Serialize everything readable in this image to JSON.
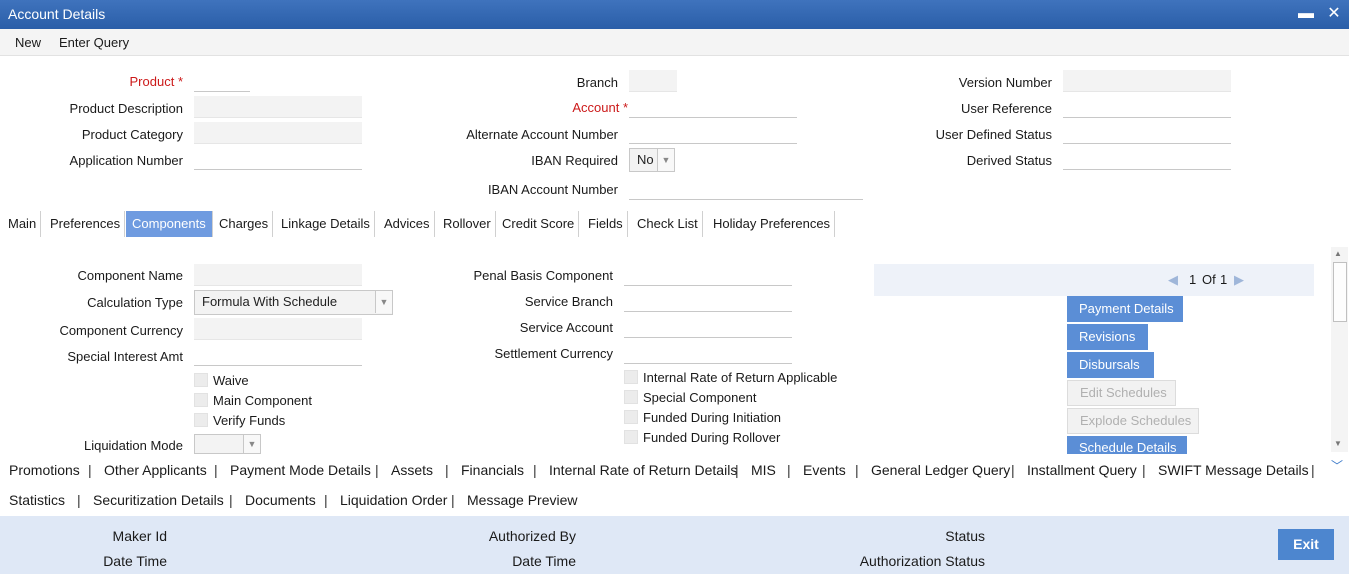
{
  "window": {
    "title": "Account Details",
    "minimize_glyph": "▬",
    "close_glyph": "✕"
  },
  "menu": {
    "new_label": "New",
    "enter_query_label": "Enter Query"
  },
  "header": {
    "product_label": "Product",
    "required_mark": "*",
    "product_description_label": "Product Description",
    "product_category_label": "Product Category",
    "application_number_label": "Application Number",
    "branch_label": "Branch",
    "account_label": "Account",
    "alternate_account_label": "Alternate Account Number",
    "iban_required_label": "IBAN Required",
    "iban_required_value": "No",
    "iban_account_label": "IBAN Account Number",
    "version_number_label": "Version Number",
    "user_reference_label": "User Reference",
    "user_defined_status_label": "User Defined Status",
    "derived_status_label": "Derived Status"
  },
  "tabs": [
    "Main",
    "Preferences",
    "Components",
    "Charges",
    "Linkage Details",
    "Advices",
    "Rollover",
    "Credit Score",
    "Fields",
    "Check List",
    "Holiday Preferences"
  ],
  "components": {
    "component_name_label": "Component Name",
    "calculation_type_label": "Calculation Type",
    "calculation_type_value": "Formula With Schedule",
    "component_currency_label": "Component Currency",
    "special_interest_label": "Special Interest Amt",
    "waive_label": "Waive",
    "main_component_label": "Main Component",
    "verify_funds_label": "Verify Funds",
    "liquidation_mode_label": "Liquidation Mode",
    "penal_basis_label": "Penal Basis Component",
    "service_branch_label": "Service Branch",
    "service_account_label": "Service Account",
    "settlement_currency_label": "Settlement Currency",
    "irr_applicable_label": "Internal Rate of Return Applicable",
    "special_component_label": "Special Component",
    "funded_initiation_label": "Funded During Initiation",
    "funded_rollover_label": "Funded During Rollover",
    "pager": {
      "current": "1",
      "of_label": "Of",
      "total": "1"
    },
    "buttons": {
      "payment_details": "Payment Details",
      "revisions": "Revisions",
      "disbursals": "Disbursals",
      "edit_schedules": "Edit Schedules",
      "explode_schedules": "Explode Schedules",
      "schedule_details": "Schedule Details"
    }
  },
  "links_row1": [
    "Promotions",
    "Other Applicants",
    "Payment Mode Details",
    "Assets",
    "Financials",
    "Internal Rate of Return Details",
    "MIS",
    "Events",
    "General Ledger Query",
    "Installment Query",
    "SWIFT Message Details"
  ],
  "links_row2": [
    "Statistics",
    "Securitization Details",
    "Documents",
    "Liquidation Order",
    "Message Preview"
  ],
  "footer": {
    "maker_id_label": "Maker Id",
    "date_time_label": "Date Time",
    "authorized_by_label": "Authorized By",
    "date_time2_label": "Date Time",
    "status_label": "Status",
    "authorization_status_label": "Authorization Status",
    "exit_label": "Exit"
  }
}
